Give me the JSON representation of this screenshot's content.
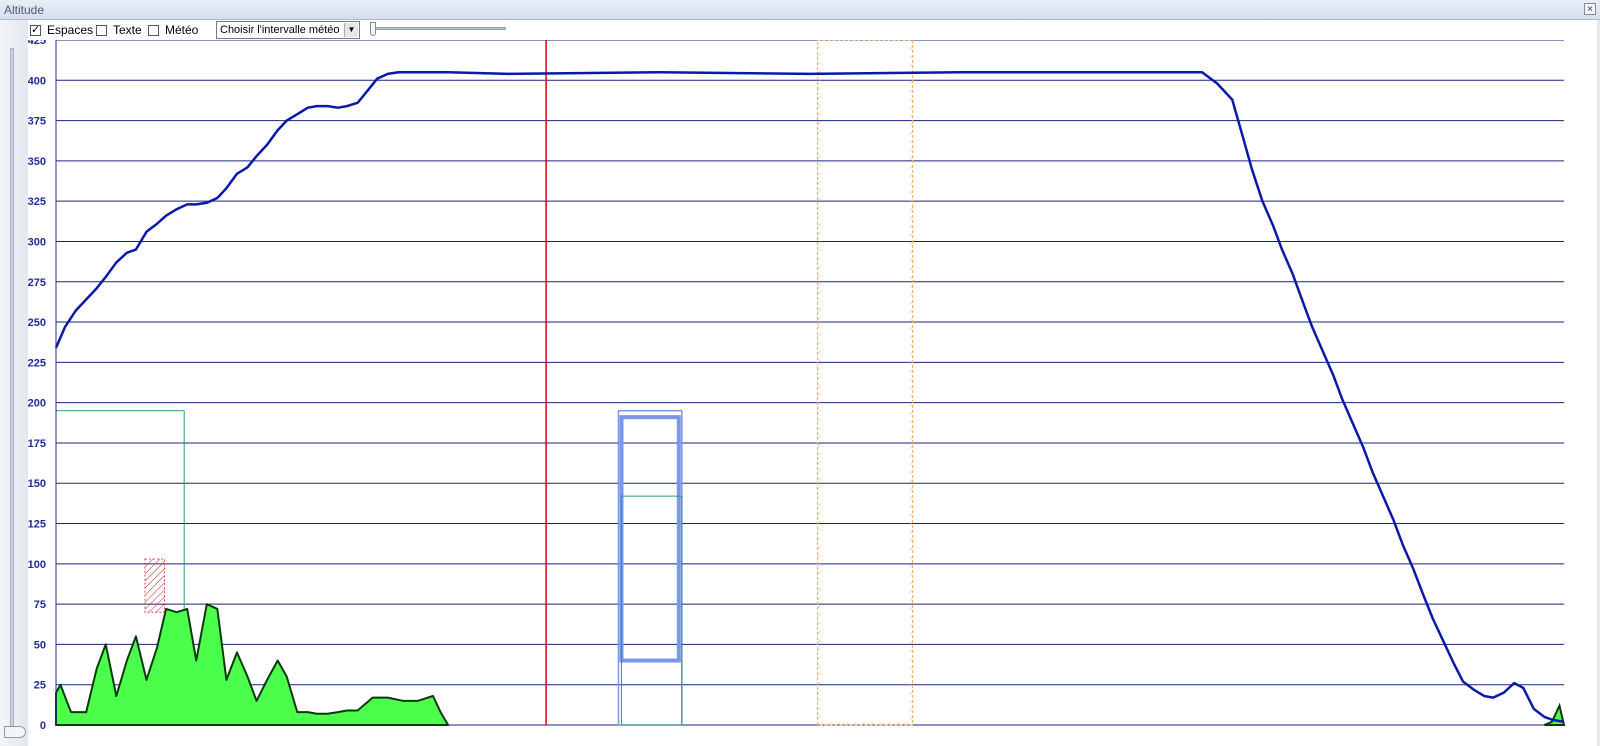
{
  "window": {
    "title": "Altitude",
    "close_icon": "close-icon"
  },
  "toolbar": {
    "espaces": {
      "label": "Espaces",
      "checked": true
    },
    "texte": {
      "label": "Texte",
      "checked": false
    },
    "meteo": {
      "label": "Météo",
      "checked": false
    },
    "meteo_interval_select": {
      "value": "Choisir l'intervalle météo",
      "icon": "chevron-down-icon"
    },
    "zoom_slider": {
      "position": 0.0
    }
  },
  "chart_data": {
    "type": "line",
    "title": "",
    "xlabel": "",
    "ylabel": "",
    "ylim": [
      0,
      425
    ],
    "y_ticks": [
      "425",
      "400",
      "375",
      "350",
      "325",
      "300",
      "275",
      "250",
      "225",
      "200",
      "175",
      "150",
      "125",
      "100",
      "75",
      "50",
      "25",
      "0"
    ],
    "x_range": [
      0,
      100
    ],
    "grid": "horizontal",
    "colors": {
      "altitude": "#0a1aa8",
      "terrain_fill": "#4cff4c",
      "terrain_line": "#0a3a0a",
      "grid": "#1a237e",
      "cursor": "#dd0000",
      "space_a": "#2e9a7a",
      "space_b": "#7a96e6",
      "weather_zone": "#f3b36b",
      "obstacle": "#cc2222"
    },
    "altitude_profile": {
      "x": [
        0,
        0.6,
        1.3,
        2.0,
        2.7,
        3.3,
        4.0,
        4.7,
        5.3,
        6.0,
        6.7,
        7.3,
        8.0,
        8.7,
        9.3,
        10.0,
        10.7,
        11.3,
        12.0,
        12.7,
        13.3,
        14.0,
        14.7,
        15.3,
        16.0,
        16.7,
        17.3,
        18.0,
        18.7,
        19.3,
        20.0,
        20.7,
        21.3,
        22.0,
        22.7,
        23.3,
        24.0,
        24.7,
        25.3,
        26.0,
        30.0,
        40.0,
        50.0,
        60.0,
        70.0,
        76.0,
        77.0,
        78.0,
        78.7,
        79.3,
        80.0,
        80.7,
        81.3,
        82.0,
        82.7,
        83.3,
        84.0,
        84.7,
        85.3,
        86.0,
        86.7,
        87.3,
        88.0,
        88.7,
        89.3,
        90.0,
        90.7,
        91.3,
        92.0,
        92.7,
        93.3,
        94.0,
        94.7,
        95.3,
        96.0,
        96.7,
        97.3,
        98.0,
        98.7,
        99.3,
        100.0
      ],
      "y": [
        234,
        247,
        257,
        264,
        271,
        278,
        287,
        293,
        295,
        306,
        311,
        316,
        320,
        323,
        323,
        324,
        327,
        333,
        342,
        346,
        353,
        360,
        369,
        375,
        379,
        383,
        384,
        384,
        383,
        384,
        386,
        394,
        401,
        404,
        405,
        405,
        405,
        405,
        405,
        405,
        404,
        405,
        404,
        405,
        405,
        405,
        398,
        388,
        365,
        345,
        325,
        310,
        295,
        280,
        262,
        247,
        232,
        217,
        202,
        187,
        172,
        157,
        142,
        127,
        112,
        97,
        80,
        66,
        52,
        38,
        27,
        22,
        18,
        17,
        20,
        26,
        23,
        10,
        5,
        3,
        2
      ]
    },
    "terrain_profile": {
      "x": [
        0,
        0.3,
        0.7,
        1.0,
        1.3,
        2.0,
        2.7,
        3.3,
        4.0,
        4.7,
        5.3,
        6.0,
        6.7,
        7.3,
        8.0,
        8.7,
        9.3,
        10.0,
        10.7,
        11.3,
        12.0,
        12.7,
        13.3,
        14.0,
        14.7,
        15.3,
        16.0,
        16.7,
        17.3,
        18.0,
        18.7,
        19.3,
        20.0,
        21.0,
        22.0,
        23.0,
        24.0,
        25.0,
        25.5,
        26.0
      ],
      "y": [
        20,
        25,
        15,
        8,
        8,
        8,
        35,
        50,
        18,
        40,
        55,
        28,
        48,
        72,
        70,
        72,
        40,
        75,
        72,
        28,
        45,
        30,
        15,
        28,
        40,
        30,
        8,
        8,
        7,
        7,
        8,
        9,
        9,
        17,
        17,
        15,
        15,
        18,
        8,
        0
      ]
    },
    "airspace_boxes": [
      {
        "name": "space-a",
        "x0": 0.0,
        "x1": 8.5,
        "y0": 0,
        "y1": 195
      },
      {
        "name": "space-b-outer",
        "x0": 37.3,
        "x1": 41.5,
        "y0": 0,
        "y1": 195
      },
      {
        "name": "space-b-inner-top",
        "x0": 37.5,
        "x1": 41.3,
        "y0": 40,
        "y1": 191
      },
      {
        "name": "space-b-inner-low",
        "x0": 37.5,
        "x1": 41.5,
        "y0": 0,
        "y1": 142
      }
    ],
    "cursor_x": 32.5,
    "weather_zone": {
      "x0": 50.5,
      "x1": 56.8,
      "y0": 0,
      "y1": 425
    },
    "obstacles": [
      {
        "x0": 5.9,
        "x1": 7.2,
        "y0": 70,
        "y1": 103
      }
    ]
  }
}
